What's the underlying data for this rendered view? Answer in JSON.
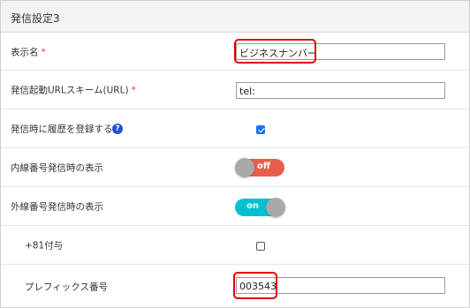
{
  "panel": {
    "title": "発信設定3"
  },
  "rows": {
    "display_name": {
      "label": "表示名",
      "required_mark": "*",
      "value": "ビジネスナンバー"
    },
    "url_scheme": {
      "label": "発信起動URLスキーム(URL)",
      "required_mark": "*",
      "value": "tel:"
    },
    "register_history": {
      "label": "発信時に履歴を登録する",
      "help_icon": "?",
      "checked": true
    },
    "internal_display": {
      "label": "内線番号発信時の表示",
      "toggle_text": "off",
      "state": "off"
    },
    "external_display": {
      "label": "外線番号発信時の表示",
      "toggle_text": "on",
      "state": "on"
    },
    "add_81": {
      "label": "+81付与",
      "checked": false
    },
    "prefix_number": {
      "label": "プレフィックス番号",
      "value": "003543"
    }
  },
  "colors": {
    "highlight": "#e10000",
    "required": "#e8363a",
    "toggle_off": "#e85e4d",
    "toggle_on": "#00c1d2",
    "checkbox_checked": "#1a73e8",
    "help_icon": "#1f4fd8"
  }
}
